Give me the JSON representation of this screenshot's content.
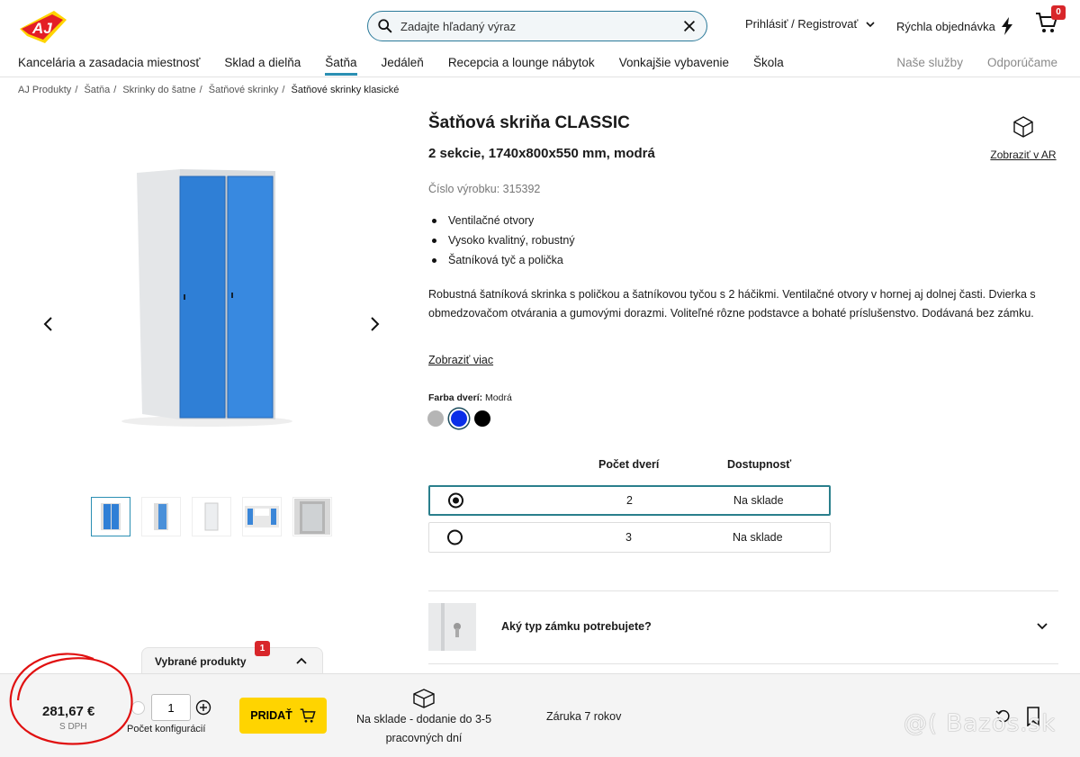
{
  "header": {
    "logo_text": "AJ",
    "search": {
      "placeholder": "Zadajte hľadaný výraz"
    },
    "login_label": "Prihlásiť / Registrovať",
    "quick_order_label": "Rýchla objednávka",
    "cart_count": "0"
  },
  "nav": {
    "items": [
      {
        "label": "Kancelária a zasadacia miestnosť"
      },
      {
        "label": "Sklad a dielňa"
      },
      {
        "label": "Šatňa"
      },
      {
        "label": "Jedáleň"
      },
      {
        "label": "Recepcia a lounge nábytok"
      },
      {
        "label": "Vonkajšie vybavenie"
      },
      {
        "label": "Škola"
      }
    ],
    "active_index": 2,
    "right": [
      {
        "label": "Naše služby"
      },
      {
        "label": "Odporúčame"
      }
    ]
  },
  "breadcrumb": [
    "AJ Produkty",
    "Šatňa",
    "Skrinky do šatne",
    "Šatňové skrinky",
    "Šatňové skrinky klasické"
  ],
  "product": {
    "title": "Šatňová skriňa CLASSIC",
    "subtitle": "2 sekcie, 1740x800x550 mm, modrá",
    "sku": "Číslo výrobku: 315392",
    "ar_label": "Zobraziť v AR",
    "bullets": [
      "Ventilačné otvory",
      "Vysoko kvalitný, robustný",
      "Šatníková tyč a polička"
    ],
    "description": "Robustná šatníková skrinka s poličkou a šatníkovou tyčou s 2 háčikmi. Ventilačné otvory v hornej aj dolnej časti. Dvierka s obmedzovačom otvárania a gumovými dorazmi. Voliteľné rôzne podstavce a bohaté príslušenstvo. Dodávaná bez zámku.",
    "more_label": "Zobraziť viac",
    "color_label": "Farba dverí:",
    "color_value": "Modrá",
    "swatches": [
      "#b5b5b5",
      "#0a2fe8",
      "#000000"
    ],
    "selected_swatch": 1
  },
  "options": {
    "head_doors": "Počet dverí",
    "head_avail": "Dostupnosť",
    "rows": [
      {
        "doors": "2",
        "avail": "Na sklade",
        "selected": true
      },
      {
        "doors": "3",
        "avail": "Na sklade",
        "selected": false
      }
    ]
  },
  "lock_question": "Aký typ zámku potrebujete?",
  "selected_products": {
    "label": "Vybrané produkty",
    "count": "1"
  },
  "bottom": {
    "price": "281,67 €",
    "vat": "S DPH",
    "qty": "1",
    "qty_label": "Počet konfigurácií",
    "add_label": "PRIDAŤ",
    "stock_line1": "Na sklade - dodanie do 3-5",
    "stock_line2": "pracovných dní",
    "warranty": "Záruka 7 rokov"
  },
  "watermark": "@( Bazos.sk",
  "colors": {
    "accent": "#2b8fb3",
    "button": "#ffd400",
    "badge": "#d8262a",
    "door_blue": "#2f7fd6"
  }
}
